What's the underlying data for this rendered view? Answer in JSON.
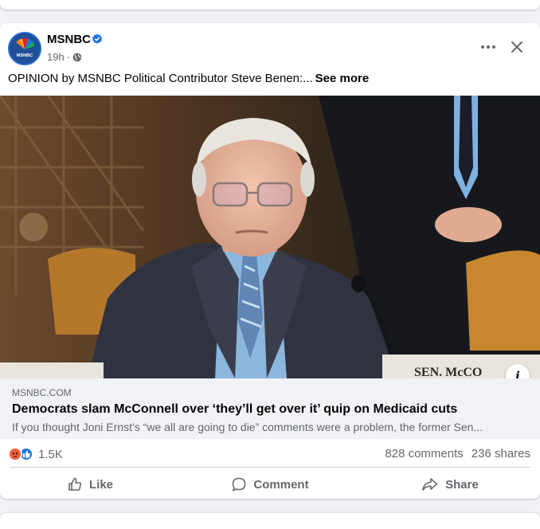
{
  "post": {
    "page_name": "MSNBC",
    "time": "19h",
    "separator": "·",
    "text": "OPINION by MSNBC Political Contributor Steve Benen:...",
    "see_more": "See more",
    "image_caption_text": "SEN. McCO",
    "avatar_text": "MSNBC"
  },
  "link": {
    "domain": "MSNBC.COM",
    "title": "Democrats slam McConnell over ‘they’ll get over it’ quip on Medicaid cuts",
    "description": "If you thought Joni Ernst’s “we all are going to die” comments were a problem, the former Sen..."
  },
  "engagement": {
    "reaction_count": "1.5K",
    "comments": "828 comments",
    "shares": "236 shares"
  },
  "actions": {
    "like": "Like",
    "comment": "Comment",
    "share": "Share"
  },
  "icons": {
    "more": "more-options-icon",
    "close": "close-icon",
    "globe": "globe-icon",
    "verified": "verified-badge-icon",
    "info": "info-icon"
  },
  "colors": {
    "accent": "#1b74e4",
    "secondary_text": "#65676b",
    "card_bg": "#ffffff",
    "page_bg": "#f0f2f5"
  }
}
